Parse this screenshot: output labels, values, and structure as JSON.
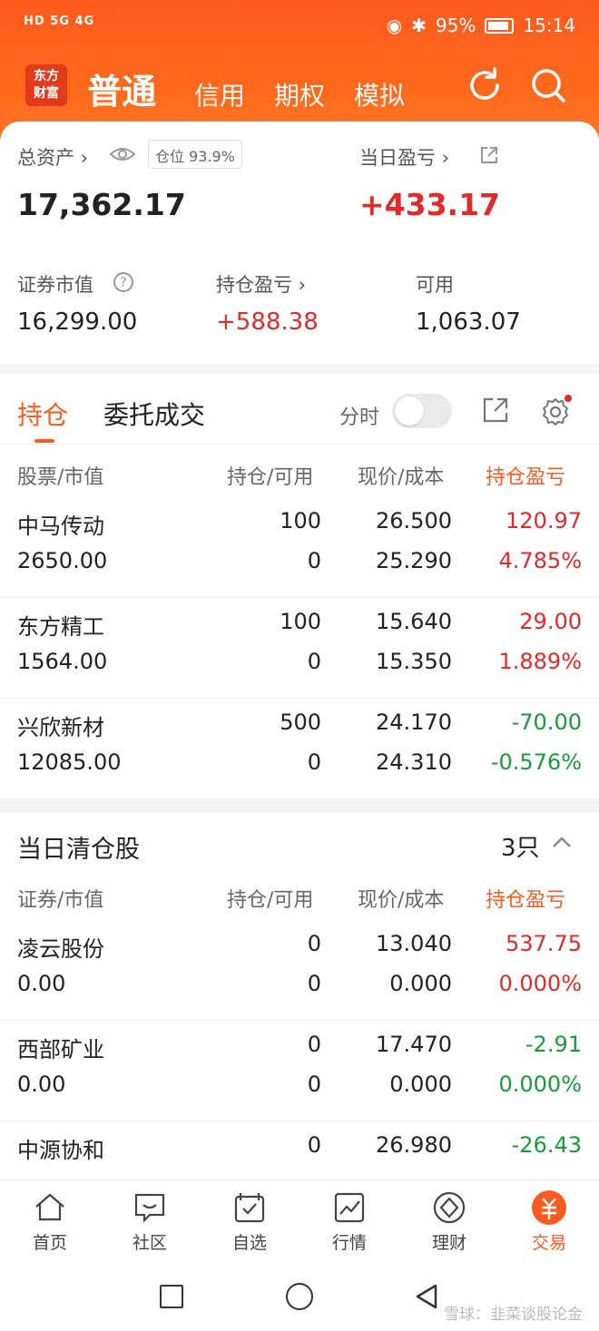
{
  "status": {
    "network": "HD 5G 4G",
    "battery": "95%",
    "time": "15:14"
  },
  "nav": {
    "logo": "东方财富",
    "tabs": [
      "普通",
      "信用",
      "期权",
      "模拟"
    ]
  },
  "summary": {
    "total_assets_label": "总资产 ›",
    "position_pill": "仓位  93.9%",
    "total_assets_value": "17,362.17",
    "daily_pnl_label": "当日盈亏 ›",
    "daily_pnl_value": "+433.17",
    "market_value_label": "证券市值",
    "market_value": "16,299.00",
    "holding_pnl_label": "持仓盈亏 ›",
    "holding_pnl": "+588.38",
    "available_label": "可用",
    "available": "1,063.07"
  },
  "positions": {
    "tabs": [
      "持仓",
      "委托成交"
    ],
    "time_share_label": "分时",
    "headers": [
      "股票/市值",
      "持仓/可用",
      "现价/成本",
      "持仓盈亏"
    ],
    "rows": [
      {
        "name": "中马传动",
        "mv": "2650.00",
        "hold": "100",
        "avail": "0",
        "price": "26.500",
        "cost": "25.290",
        "pnl": "120.97",
        "pct": "4.785%",
        "dir": "up"
      },
      {
        "name": "东方精工",
        "mv": "1564.00",
        "hold": "100",
        "avail": "0",
        "price": "15.640",
        "cost": "15.350",
        "pnl": "29.00",
        "pct": "1.889%",
        "dir": "up"
      },
      {
        "name": "兴欣新材",
        "mv": "12085.00",
        "hold": "500",
        "avail": "0",
        "price": "24.170",
        "cost": "24.310",
        "pnl": "-70.00",
        "pct": "-0.576%",
        "dir": "down"
      }
    ]
  },
  "cleared": {
    "title": "当日清仓股",
    "count": "3只",
    "headers": [
      "证券/市值",
      "持仓/可用",
      "现价/成本",
      "持仓盈亏"
    ],
    "rows": [
      {
        "name": "凌云股份",
        "mv": "0.00",
        "hold": "0",
        "avail": "0",
        "price": "13.040",
        "cost": "0.000",
        "pnl": "537.75",
        "pct": "0.000%",
        "dir": "up"
      },
      {
        "name": "西部矿业",
        "mv": "0.00",
        "hold": "0",
        "avail": "0",
        "price": "17.470",
        "cost": "0.000",
        "pnl": "-2.91",
        "pct": "0.000%",
        "dir": "down"
      },
      {
        "name": "中源协和",
        "mv": "",
        "hold": "0",
        "avail": "",
        "price": "26.980",
        "cost": "",
        "pnl": "-26.43",
        "pct": "",
        "dir": "down"
      }
    ]
  },
  "bottom_nav": [
    "首页",
    "社区",
    "自选",
    "行情",
    "理财",
    "交易"
  ],
  "watermark": "雪球：韭菜谈股论金",
  "colors": {
    "accent": "#ff5a1f",
    "up": "#e12a2a",
    "down": "#1a9a3a"
  }
}
